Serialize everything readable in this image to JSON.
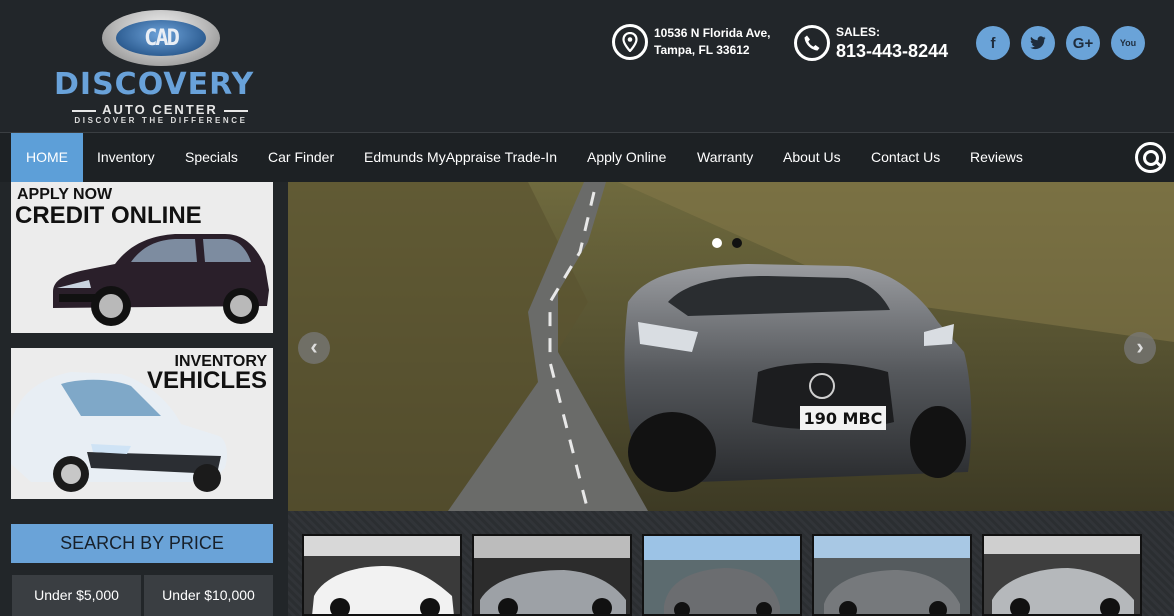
{
  "header": {
    "logo": {
      "mark": "CAD",
      "name": "DISCOVERY",
      "subtitle": "AUTO CENTER",
      "tagline": "DISCOVER THE DIFFERENCE"
    },
    "address": {
      "line1": "10536 N Florida Ave,",
      "line2": "Tampa, FL 33612"
    },
    "sales": {
      "label": "SALES:",
      "phone": "813-443-8244"
    },
    "social": [
      {
        "name": "facebook",
        "glyph": "f"
      },
      {
        "name": "twitter",
        "glyph": "t"
      },
      {
        "name": "google-plus",
        "glyph": "G+"
      },
      {
        "name": "youtube",
        "glyph": "You"
      }
    ]
  },
  "nav": {
    "items": [
      {
        "label": "HOME",
        "active": true
      },
      {
        "label": "Inventory"
      },
      {
        "label": "Specials"
      },
      {
        "label": "Car Finder"
      },
      {
        "label": "Edmunds MyAppraise Trade-In"
      },
      {
        "label": "Apply Online"
      },
      {
        "label": "Warranty"
      },
      {
        "label": "About Us"
      },
      {
        "label": "Contact Us"
      },
      {
        "label": "Reviews"
      }
    ],
    "active_color": "#5d9fd8"
  },
  "sidebar": {
    "promo_credit": {
      "line1": "APPLY NOW",
      "line2": "CREDIT ONLINE"
    },
    "promo_inventory": {
      "line1": "INVENTORY",
      "line2": "VEHICLES"
    },
    "price": {
      "heading": "SEARCH BY PRICE",
      "buttons": [
        "Under $5,000",
        "Under $10,000"
      ]
    }
  },
  "hero": {
    "plate": "190 MBC",
    "prev_glyph": "‹",
    "next_glyph": "›",
    "slide_count": 2,
    "active_slide": 1
  },
  "thumbnails": [
    {
      "car": "white Porsche 911"
    },
    {
      "car": "silver BMW i8"
    },
    {
      "car": "grey Maserati sedan"
    },
    {
      "car": "grey Maserati Ghibli"
    },
    {
      "car": "silver Porsche 911"
    }
  ],
  "colors": {
    "accent": "#6aa3d8",
    "background": "#222629"
  }
}
